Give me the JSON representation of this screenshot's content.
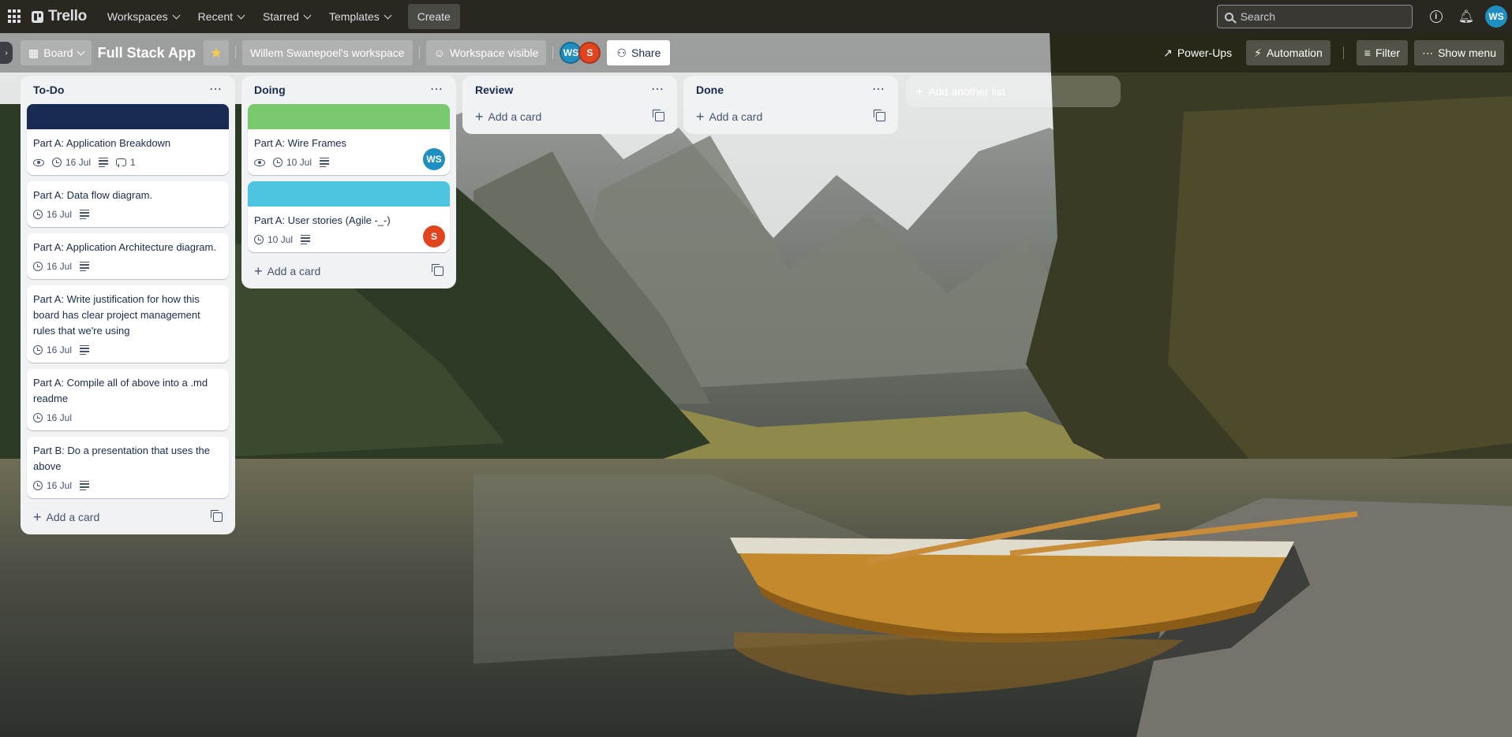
{
  "header": {
    "app_name": "Trello",
    "menu": [
      {
        "label": "Workspaces"
      },
      {
        "label": "Recent"
      },
      {
        "label": "Starred"
      },
      {
        "label": "Templates"
      }
    ],
    "create_label": "Create",
    "search_placeholder": "Search",
    "account_initials": "WS"
  },
  "board": {
    "view_label": "Board",
    "title": "Full Stack App",
    "workspace_label": "Willem Swanepoel's workspace",
    "visibility_label": "Workspace visible",
    "members": [
      {
        "initials": "WS",
        "color": "#1f8fc1"
      },
      {
        "initials": "S",
        "color": "#e0451f"
      }
    ],
    "share_label": "Share",
    "powerups_label": "Power-Ups",
    "automation_label": "Automation",
    "filter_label": "Filter",
    "show_menu_label": "Show menu"
  },
  "lists": [
    {
      "title": "To-Do",
      "add_card_label": "Add a card",
      "cards": [
        {
          "title": "Part A: Application Breakdown",
          "cover": "#172b53",
          "watch": true,
          "date": "16 Jul",
          "description": true,
          "comments": "1",
          "member": null
        },
        {
          "title": "Part A: Data flow diagram.",
          "cover": null,
          "watch": false,
          "date": "16 Jul",
          "description": true,
          "comments": null,
          "member": null
        },
        {
          "title": "Part A: Application Architecture diagram.",
          "cover": null,
          "watch": false,
          "date": "16 Jul",
          "description": true,
          "comments": null,
          "member": null
        },
        {
          "title": "Part A: Write justification for how this board has clear project management rules that we're using",
          "cover": null,
          "watch": false,
          "date": "16 Jul",
          "description": true,
          "comments": null,
          "member": null
        },
        {
          "title": "Part A: Compile all of above into a .md readme",
          "cover": null,
          "watch": false,
          "date": "16 Jul",
          "description": false,
          "comments": null,
          "member": null
        },
        {
          "title": "Part B: Do a presentation that uses the above",
          "cover": null,
          "watch": false,
          "date": "16 Jul",
          "description": true,
          "comments": null,
          "member": null
        }
      ]
    },
    {
      "title": "Doing",
      "add_card_label": "Add a card",
      "cards": [
        {
          "title": "Part A: Wire Frames",
          "cover": "#7bc96f",
          "watch": true,
          "date": "10 Jul",
          "description": true,
          "comments": null,
          "member": {
            "initials": "WS",
            "color": "#1f8fc1"
          }
        },
        {
          "title": "Part A: User stories (Agile -_-)",
          "cover": "#4ec5e0",
          "watch": false,
          "date": "10 Jul",
          "description": true,
          "comments": null,
          "member": {
            "initials": "S",
            "color": "#e0451f"
          }
        }
      ]
    },
    {
      "title": "Review",
      "add_card_label": "Add a card",
      "cards": []
    },
    {
      "title": "Done",
      "add_card_label": "Add a card",
      "cards": []
    }
  ],
  "add_list_label": "Add another list"
}
